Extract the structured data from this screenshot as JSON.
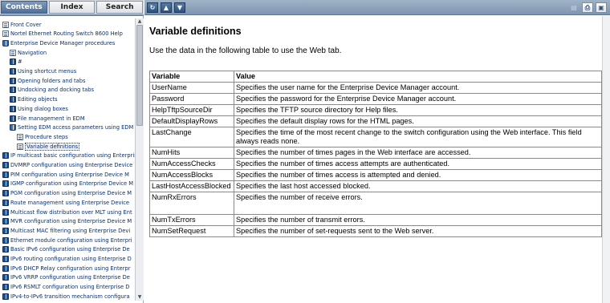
{
  "nav": {
    "tabs": [
      {
        "label": "Contents",
        "active": true
      },
      {
        "label": "Index",
        "active": false
      },
      {
        "label": "Search",
        "active": false
      }
    ],
    "tree": [
      {
        "label": "Front Cover",
        "icon": "page-icon",
        "level": 0
      },
      {
        "label": "Nortel Ethernet Routing Switch 8600 Help",
        "icon": "page-icon",
        "level": 0
      },
      {
        "label": "Enterprise Device Manager procedures",
        "icon": "open-book-icon",
        "level": 0
      },
      {
        "label": "Navigation",
        "icon": "page-icon",
        "level": 1
      },
      {
        "label": "#",
        "icon": "book-icon",
        "level": 1
      },
      {
        "label": "Using shortcut menus",
        "icon": "book-icon",
        "level": 1
      },
      {
        "label": "Opening folders and tabs",
        "icon": "book-icon",
        "level": 1
      },
      {
        "label": "Undocking and docking tabs",
        "icon": "book-icon",
        "level": 1
      },
      {
        "label": "Editing objects",
        "icon": "book-icon",
        "level": 1
      },
      {
        "label": "Using dialog boxes",
        "icon": "book-icon",
        "level": 1
      },
      {
        "label": "File management in EDM",
        "icon": "book-icon",
        "level": 1
      },
      {
        "label": "Setting EDM access parameters using EDM",
        "icon": "open-book-icon",
        "level": 1
      },
      {
        "label": "Procedure steps",
        "icon": "page-icon",
        "level": 2
      },
      {
        "label": "Variable definitions",
        "icon": "page-icon",
        "level": 2,
        "current": true
      },
      {
        "label": "IP multicast basic configuration using Enterprise",
        "icon": "book-icon",
        "level": 0
      },
      {
        "label": "DVMRP configuration using Enterprise Device",
        "icon": "book-icon",
        "level": 0
      },
      {
        "label": "PIM configuration using Enterprise Device M",
        "icon": "book-icon",
        "level": 0
      },
      {
        "label": "IGMP configuration using Enterprise Device M",
        "icon": "book-icon",
        "level": 0
      },
      {
        "label": "PGM configuration using Enterprise Device M",
        "icon": "book-icon",
        "level": 0
      },
      {
        "label": "Route management using Enterprise Device",
        "icon": "book-icon",
        "level": 0
      },
      {
        "label": "Multicast flow distribution over MLT using Ent",
        "icon": "book-icon",
        "level": 0
      },
      {
        "label": "MVR configuration using Enterprise Device M",
        "icon": "book-icon",
        "level": 0
      },
      {
        "label": "Multicast MAC filtering using Enterprise Devi",
        "icon": "book-icon",
        "level": 0
      },
      {
        "label": "Ethernet module configuration using Enterpri",
        "icon": "book-icon",
        "level": 0
      },
      {
        "label": "Basic IPv6 configuration using Enterprise De",
        "icon": "book-icon",
        "level": 0
      },
      {
        "label": "IPv6 routing configuration using Enterprise D",
        "icon": "book-icon",
        "level": 0
      },
      {
        "label": "IPv6 DHCP Relay configuration using Enterpr",
        "icon": "book-icon",
        "level": 0
      },
      {
        "label": "IPv6 VRRP configuration using Enterprise De",
        "icon": "book-icon",
        "level": 0
      },
      {
        "label": "IPv6 RSMLT configuration using Enterprise D",
        "icon": "book-icon",
        "level": 0
      },
      {
        "label": "IPv4-to-IPv6 transition mechanism configura",
        "icon": "book-icon",
        "level": 0
      }
    ]
  },
  "toolbar": {
    "sync_icon": "sync-toc-icon",
    "prev_icon": "previous-topic-icon",
    "next_icon": "next-topic-icon",
    "right_icons": [
      "highlight-icon",
      "print-icon",
      "print-topic-icon"
    ]
  },
  "content": {
    "title": "Variable definitions",
    "intro": "Use the data in the following table to use the Web tab.",
    "table": {
      "headers": [
        "Variable",
        "Value"
      ],
      "rows": [
        [
          "UserName",
          "Specifies the user name for the Enterprise Device Manager account."
        ],
        [
          "Password",
          "Specifies the password for the Enterprise Device Manager account."
        ],
        [
          "HelpTftpSourceDir",
          "Specifies the TFTP source directory for Help files."
        ],
        [
          "DefaultDisplayRows",
          "Specifies the default display rows for the HTML pages."
        ],
        [
          "LastChange",
          "Specifies the time of the most recent change to the switch configuration using the Web interface. This field always reads none."
        ],
        [
          "NumHits",
          "Specifies the number of times pages in the Web interface are accessed."
        ],
        [
          "NumAccessChecks",
          "Specifies the number of times access attempts are authenticated."
        ],
        [
          "NumAccessBlocks",
          "Specifies the number of times access is attempted and denied."
        ],
        [
          "LastHostAccessBlocked",
          "Specifies the last host accessed blocked."
        ],
        [
          "NumRxErrors",
          "Specifies the number of receive errors."
        ],
        [
          "NumTxErrors",
          "Specifies the number of transmit errors."
        ],
        [
          "NumSetRequest",
          "Specifies the number of set-requests sent to the Web server."
        ]
      ]
    }
  }
}
